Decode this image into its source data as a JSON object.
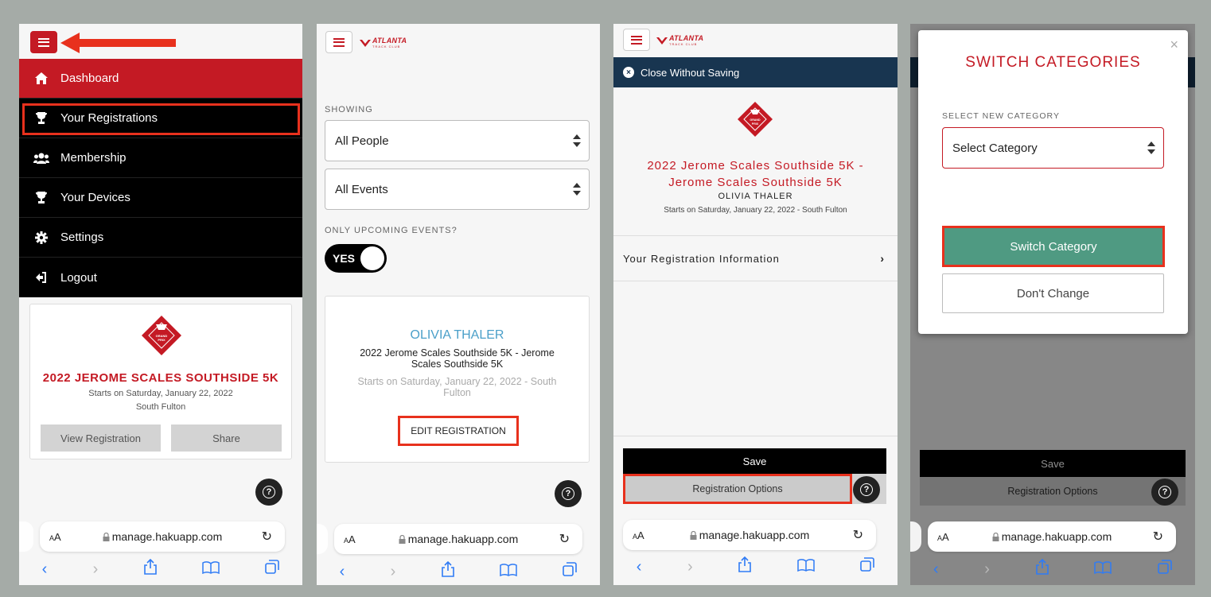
{
  "screen1": {
    "menu": [
      {
        "label": "Dashboard",
        "icon": "home-icon"
      },
      {
        "label": "Your Registrations",
        "icon": "trophy-icon"
      },
      {
        "label": "Membership",
        "icon": "users-icon"
      },
      {
        "label": "Your Devices",
        "icon": "trophy-icon"
      },
      {
        "label": "Settings",
        "icon": "gear-icon"
      },
      {
        "label": "Logout",
        "icon": "logout-icon"
      }
    ],
    "event": {
      "title": "2022 JEROME SCALES SOUTHSIDE 5K",
      "date": "Starts on Saturday, January 22, 2022",
      "location": "South Fulton",
      "view_label": "View Registration",
      "share_label": "Share"
    },
    "url": "manage.hakuapp.com"
  },
  "screen2": {
    "showing_label": "SHOWING",
    "people_select": "All People",
    "events_select": "All Events",
    "upcoming_label": "ONLY UPCOMING EVENTS?",
    "toggle_label": "YES",
    "person": "OLIVIA THALER",
    "event_name": "2022 Jerome Scales Southside 5K - Jerome Scales Southside 5K",
    "starts": "Starts on Saturday, January 22, 2022 - South Fulton",
    "edit_label": "EDIT REGISTRATION",
    "url": "manage.hakuapp.com"
  },
  "screen3": {
    "close_label": "Close Without Saving",
    "event_title": "2022 Jerome Scales Southside 5K - Jerome Scales Southside 5K",
    "person": "OLIVIA THALER",
    "starts": "Starts on Saturday, January 22, 2022 - South Fulton",
    "info_label": "Your Registration Information",
    "save_label": "Save",
    "options_label": "Registration Options",
    "url": "manage.hakuapp.com"
  },
  "screen4": {
    "modal_title": "SWITCH CATEGORIES",
    "select_label": "SELECT NEW CATEGORY",
    "select_value": "Select Category",
    "switch_label": "Switch Category",
    "dont_label": "Don't Change",
    "save_label": "Save",
    "options_label": "Registration Options",
    "url": "manage.hakuapp.com"
  },
  "brand": {
    "logo_text": "ATLANTA",
    "logo_sub": "TRACK CLUB",
    "badge_top": "GRAND",
    "badge_bottom": "PRIX"
  },
  "colors": {
    "brand_red": "#c41a24",
    "highlight": "#e8311d",
    "navy": "#183550",
    "teal": "#4f9a82",
    "link_blue": "#2f7bf5",
    "person_blue": "#4a9fc9"
  }
}
